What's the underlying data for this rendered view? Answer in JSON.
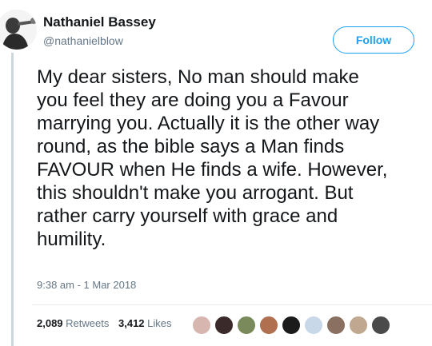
{
  "user": {
    "name": "Nathaniel Bassey",
    "handle": "@nathanielblow"
  },
  "follow_button": {
    "label": "Follow"
  },
  "tweet": {
    "text": "My dear sisters, No man should make\nyou feel they are doing you a Favour\nmarrying you. Actually it is the other way\nround, as the bible says a Man finds\nFAVOUR when He finds a wife. However,\nthis shouldn't make you arrogant. But\nrather carry yourself with grace and\nhumility.",
    "timestamp": "9:38 am - 1 Mar 2018"
  },
  "stats": {
    "retweets_count": "2,089",
    "retweets_label": "Retweets",
    "likes_count": "3,412",
    "likes_label": "Likes"
  },
  "likers": [
    {
      "color": "#d8b6b0"
    },
    {
      "color": "#3a2a2a"
    },
    {
      "color": "#7a8a5a"
    },
    {
      "color": "#b07050"
    },
    {
      "color": "#1b1b1b"
    },
    {
      "color": "#c8d8e8"
    },
    {
      "color": "#8a7060"
    },
    {
      "color": "#c0a890"
    },
    {
      "color": "#4a4a4a"
    }
  ],
  "colors": {
    "accent": "#1da1f2",
    "text_primary": "#14171a",
    "text_secondary": "#657786",
    "thread_line": "#ccd6dd"
  }
}
